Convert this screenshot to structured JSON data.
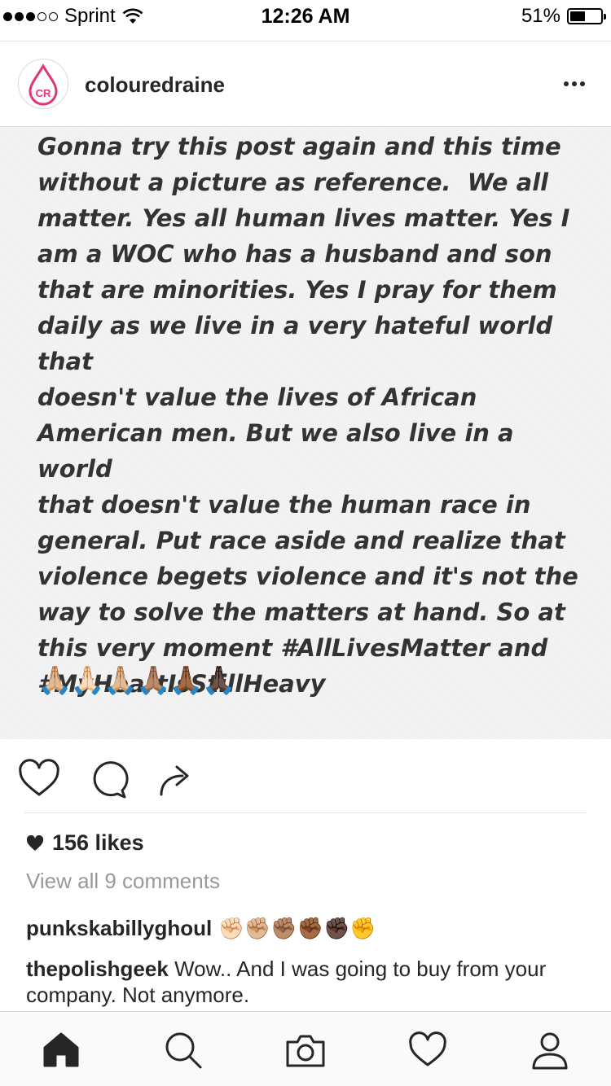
{
  "status_bar": {
    "carrier": "Sprint",
    "time": "12:26 AM",
    "battery": "51%",
    "battery_level": 0.51,
    "signal_bars_filled": 3,
    "signal_bars_total": 5
  },
  "post": {
    "username": "colouredraine",
    "avatar_text": "CR",
    "more_icon": "more-dots-icon",
    "image_text": "Gonna try this post again and this time\nwithout a picture as reference.  We all\nmatter. Yes all human lives matter. Yes I\nam a WOC who has a husband and son\nthat are minorities. Yes I pray for them\ndaily as we live in a very hateful world that\ndoesn't value the lives of African\nAmerican men. But we also live in a world\nthat doesn't value the human race in\ngeneral. Put race aside and realize that\nviolence begets violence and it's not the\nway to solve the matters at hand. So at\nthis very moment #AllLivesMatter and\n#MyHeartIsStillHeavy",
    "image_emojis": "🙏🏼🙏🏻🙏🏼🙏🏽🙏🏾🙏🏿",
    "likes": "156 likes",
    "view_comments": "View all 9 comments",
    "comments": [
      {
        "user": "punkskabillyghoul",
        "text": "✊🏻✊🏼✊🏽✊🏾✊🏿✊"
      },
      {
        "user": "thepolishgeek",
        "text": "Wow.. And I was going to buy from your company. Not anymore."
      }
    ]
  },
  "colors": {
    "text": "#262626",
    "muted": "#999999",
    "brand_pink": "#e0357a"
  },
  "tabs": [
    {
      "name": "home",
      "icon": "home-icon"
    },
    {
      "name": "search",
      "icon": "search-icon"
    },
    {
      "name": "camera",
      "icon": "camera-icon"
    },
    {
      "name": "activity",
      "icon": "heart-icon"
    },
    {
      "name": "profile",
      "icon": "person-icon"
    }
  ]
}
